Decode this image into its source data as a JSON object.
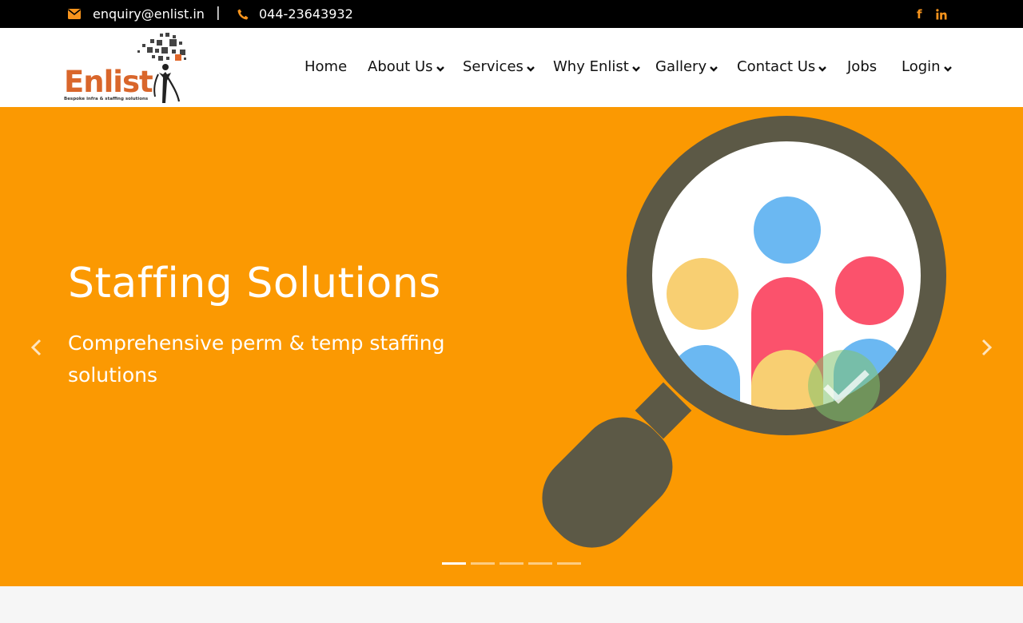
{
  "topbar": {
    "email": "enquiry@enlist.in",
    "separator": "|",
    "phone": "044-23643932",
    "email_icon": "envelope-icon",
    "phone_icon": "phone-icon",
    "social": [
      "facebook-icon",
      "linkedin-icon"
    ]
  },
  "logo": {
    "word": "Enlist",
    "tagline": "Bespoke infra & staffing solutions"
  },
  "nav": {
    "home": "Home",
    "about": "About Us",
    "services": "Services",
    "why": "Why Enlist",
    "gallery": "Gallery",
    "contact": "Contact Us",
    "jobs": "Jobs",
    "login": "Login"
  },
  "hero": {
    "title": "Staffing Solutions",
    "subtitle": "Comprehensive perm & temp staffing solutions",
    "slide_count": 5,
    "active_slide": 1
  },
  "colors": {
    "accent": "#f7941d",
    "hero_bg": "#fb9902",
    "logo": "#d9662b"
  }
}
